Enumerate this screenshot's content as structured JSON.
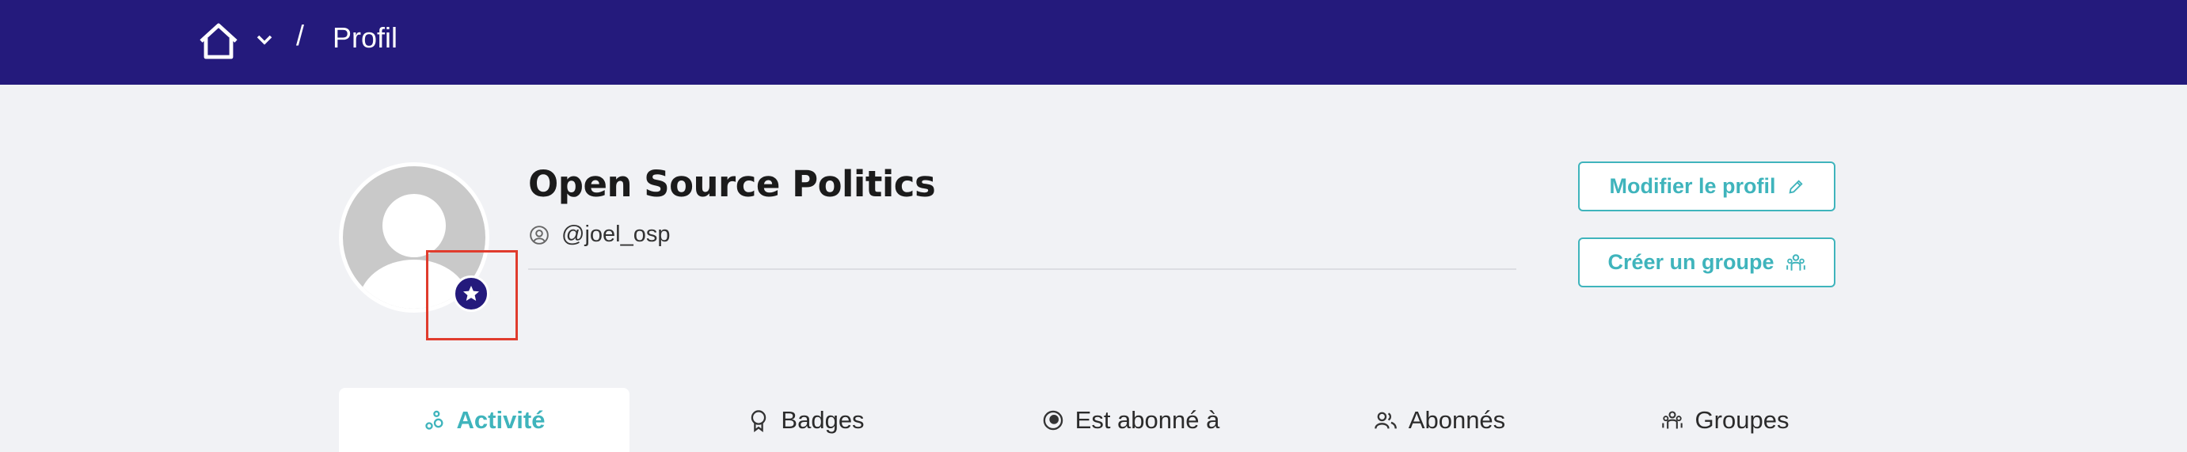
{
  "breadcrumb": {
    "separator": "/",
    "current": "Profil"
  },
  "profile": {
    "name": "Open Source Politics",
    "nickname": "@joel_osp"
  },
  "actions": {
    "edit_label": "Modifier le profil",
    "create_group_label": "Créer un groupe"
  },
  "tabs": [
    {
      "label": "Activité",
      "icon": "activity-icon",
      "active": true
    },
    {
      "label": "Badges",
      "icon": "badge-icon",
      "active": false
    },
    {
      "label": "Est abonné à",
      "icon": "following-icon",
      "active": false
    },
    {
      "label": "Abonnés",
      "icon": "followers-icon",
      "active": false
    },
    {
      "label": "Groupes",
      "icon": "groups-icon",
      "active": false
    }
  ],
  "colors": {
    "header": "#241a7c",
    "accent": "#3fb4bc",
    "background": "#f1f2f5",
    "highlight": "#e03c2d"
  }
}
